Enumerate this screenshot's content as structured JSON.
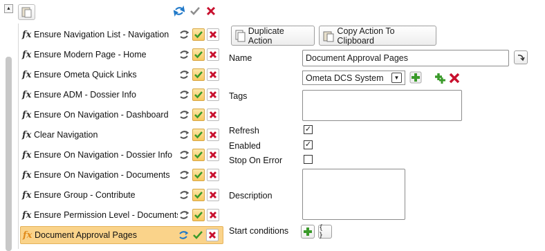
{
  "toolbar": {
    "scroll_up_glyph": "▲",
    "copy_icon": "clipboard-paste-icon",
    "top_icons": [
      "refresh-icon",
      "check-icon",
      "delete-icon"
    ]
  },
  "actions": [
    {
      "label": "Ensure Navigation List - Navigation",
      "type_icon": "fx"
    },
    {
      "label": "Ensure Modern Page - Home",
      "type_icon": "fx"
    },
    {
      "label": "Ensure Ometa Quick Links",
      "type_icon": "fx"
    },
    {
      "label": "Ensure ADM - Dossier Info",
      "type_icon": "fx"
    },
    {
      "label": "Ensure On Navigation - Dashboard",
      "type_icon": "fx"
    },
    {
      "label": "Clear Navigation",
      "type_icon": "fx"
    },
    {
      "label": "Ensure On Navigation - Dossier Info",
      "type_icon": "fx"
    },
    {
      "label": "Ensure On Navigation - Documents",
      "type_icon": "fx"
    },
    {
      "label": "Ensure Group - Contribute",
      "type_icon": "fx"
    },
    {
      "label": "Ensure Permission Level - Documents",
      "type_icon": "fx"
    },
    {
      "label": "Document Approval Pages",
      "type_icon": "fx",
      "selected": true
    }
  ],
  "detail": {
    "duplicate_label": "Duplicate Action",
    "copy_label": "Copy Action To Clipboard",
    "name_label": "Name",
    "name_value": "Document Approval Pages",
    "system_value": "Ometa DCS System",
    "tags_label": "Tags",
    "refresh_label": "Refresh",
    "enabled_label": "Enabled",
    "stop_on_error_label": "Stop On Error",
    "description_label": "Description",
    "start_conditions_label": "Start conditions",
    "braces": "{ }",
    "check_mark": "✓",
    "dropdown_glyph": "▼"
  },
  "colors": {
    "selected_bg": "#fad38a",
    "check_green": "#3a9a2a",
    "delete_red": "#c8102e",
    "refresh_blue": "#1f78c8"
  }
}
